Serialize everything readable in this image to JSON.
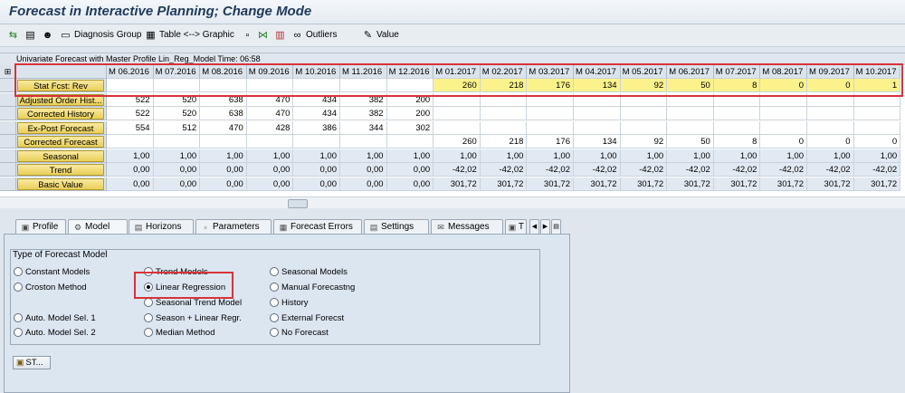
{
  "window": {
    "title": "Forecast in Interactive Planning; Change Mode"
  },
  "toolbar": {
    "items": [
      {
        "label": "",
        "icon": "back-arrows-icon"
      },
      {
        "label": "",
        "icon": "graph-icon"
      },
      {
        "label": "",
        "icon": "people-icon"
      },
      {
        "label": "Diagnosis Group",
        "icon": "diagnosis-icon"
      },
      {
        "label": "Table <--> Graphic",
        "icon": "table-icon"
      },
      {
        "label": "",
        "icon": "square-icon"
      },
      {
        "label": "",
        "icon": "bowtie-icon"
      },
      {
        "label": "",
        "icon": "calculator-icon"
      },
      {
        "label": "Outliers",
        "icon": "glasses-icon"
      },
      {
        "label": "Value",
        "icon": "pencil-icon"
      }
    ]
  },
  "caption": "Univariate Forecast with Master Profile Lin_Reg_Model Time: 06:58",
  "table": {
    "columns": [
      "M 06.2016",
      "M 07.2016",
      "M 08.2016",
      "M 09.2016",
      "M 10.2016",
      "M 11.2016",
      "M 12.2016",
      "M 01.2017",
      "M 02.2017",
      "M 03.2017",
      "M 04.2017",
      "M 05.2017",
      "M 06.2017",
      "M 07.2017",
      "M 08.2017",
      "M 09.2017",
      "M 10.2017"
    ],
    "rows": [
      {
        "label": "Stat Fcst: Rev",
        "values": [
          "",
          "",
          "",
          "",
          "",
          "",
          "",
          "260",
          "218",
          "176",
          "134",
          "92",
          "50",
          "8",
          "0",
          "0",
          "1"
        ],
        "style": "yellow"
      },
      {
        "label": "Adjusted Order Hist...",
        "values": [
          "522",
          "520",
          "638",
          "470",
          "434",
          "382",
          "200",
          "",
          "",
          "",
          "",
          "",
          "",
          "",
          "",
          "",
          ""
        ],
        "style": "white"
      },
      {
        "label": "Corrected History",
        "values": [
          "522",
          "520",
          "638",
          "470",
          "434",
          "382",
          "200",
          "",
          "",
          "",
          "",
          "",
          "",
          "",
          "",
          "",
          ""
        ],
        "style": "white"
      },
      {
        "label": "Ex-Post Forecast",
        "values": [
          "554",
          "512",
          "470",
          "428",
          "386",
          "344",
          "302",
          "",
          "",
          "",
          "",
          "",
          "",
          "",
          "",
          "",
          ""
        ],
        "style": "white"
      },
      {
        "label": "Corrected Forecast",
        "values": [
          "",
          "",
          "",
          "",
          "",
          "",
          "",
          "260",
          "218",
          "176",
          "134",
          "92",
          "50",
          "8",
          "0",
          "0",
          "0"
        ],
        "style": "white"
      },
      {
        "label": "Seasonal",
        "values": [
          "1,00",
          "1,00",
          "1,00",
          "1,00",
          "1,00",
          "1,00",
          "1,00",
          "1,00",
          "1,00",
          "1,00",
          "1,00",
          "1,00",
          "1,00",
          "1,00",
          "1,00",
          "1,00",
          "1,00"
        ],
        "style": "blue"
      },
      {
        "label": "Trend",
        "values": [
          "0,00",
          "0,00",
          "0,00",
          "0,00",
          "0,00",
          "0,00",
          "0,00",
          "-42,02",
          "-42,02",
          "-42,02",
          "-42,02",
          "-42,02",
          "-42,02",
          "-42,02",
          "-42,02",
          "-42,02",
          "-42,02"
        ],
        "style": "blue"
      },
      {
        "label": "Basic Value",
        "values": [
          "0,00",
          "0,00",
          "0,00",
          "0,00",
          "0,00",
          "0,00",
          "0,00",
          "301,72",
          "301,72",
          "301,72",
          "301,72",
          "301,72",
          "301,72",
          "301,72",
          "301,72",
          "301,72",
          "301,72"
        ],
        "style": "blue"
      }
    ]
  },
  "tabs": [
    {
      "label": "Profile",
      "icon": "profile-icon",
      "active": false
    },
    {
      "label": "Model",
      "icon": "model-icon",
      "active": true
    },
    {
      "label": "Horizons",
      "icon": "horizons-icon",
      "active": false
    },
    {
      "label": "Parameters",
      "icon": "parameters-icon",
      "active": false
    },
    {
      "label": "Forecast Errors",
      "icon": "errors-icon",
      "active": false
    },
    {
      "label": "Settings",
      "icon": "settings-icon",
      "active": false
    },
    {
      "label": "Messages",
      "icon": "messages-icon",
      "active": false
    },
    {
      "label": "T",
      "icon": "more-icon",
      "active": false
    }
  ],
  "model_panel": {
    "group_title": "Type of Forecast Model",
    "options": [
      {
        "label": "Constant Models",
        "selected": false
      },
      {
        "label": "Croston Method",
        "selected": false
      },
      {
        "label": "Auto. Model Sel. 1",
        "selected": false
      },
      {
        "label": "Auto. Model Sel. 2",
        "selected": false
      },
      {
        "label": "Trend Models",
        "selected": false
      },
      {
        "label": "Linear Regression",
        "selected": true
      },
      {
        "label": "Seasonal Trend Model",
        "selected": false
      },
      {
        "label": "Season + Linear Regr.",
        "selected": false
      },
      {
        "label": "Median Method",
        "selected": false
      },
      {
        "label": "Seasonal Models",
        "selected": false
      },
      {
        "label": "Manual Forecastng",
        "selected": false
      },
      {
        "label": "History",
        "selected": false
      },
      {
        "label": "External Forecst",
        "selected": false
      },
      {
        "label": "No Forecast",
        "selected": false
      }
    ],
    "st_button": "ST..."
  },
  "colors": {
    "highlight": "#d9323a",
    "yellow_row": "#fbf28c",
    "row_button": "#e9cf58"
  }
}
